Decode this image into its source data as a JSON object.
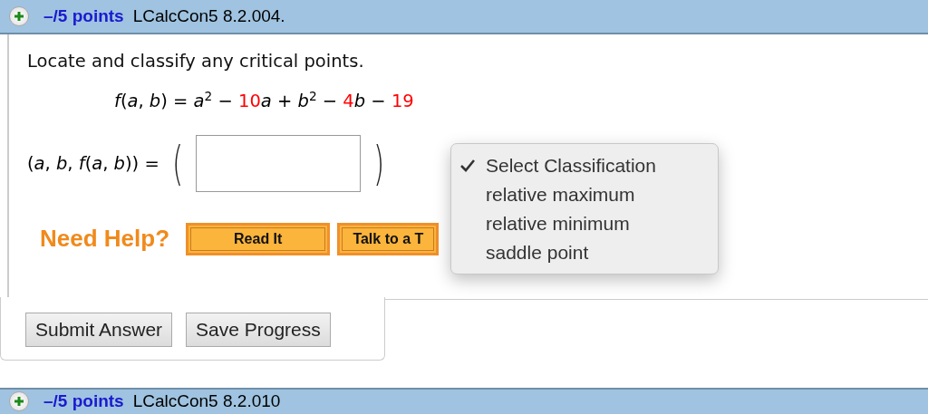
{
  "question_header": {
    "points": "–/5 points",
    "code": "LCalcCon5 8.2.004.",
    "expanded": false
  },
  "prompt": "Locate and classify any critical points.",
  "formula": [
    {
      "text": "*f*(*a*, *b*) = *a*$^{2}$ − ",
      "color": "#000000"
    },
    {
      "text": "10",
      "color": "#ff0000"
    },
    {
      "text": "*a* + *b*$^{2}$ − ",
      "color": "#000000"
    },
    {
      "text": "4",
      "color": "#ff0000"
    },
    {
      "text": "*b* − ",
      "color": "#000000"
    },
    {
      "text": "19",
      "color": "#ff0000"
    }
  ],
  "answer": {
    "label": "(*a*, *b*, *f*(*a*, *b*)) =",
    "open_paren": "(",
    "close_paren": ")"
  },
  "help": {
    "label": "Need Help?",
    "buttons": [
      "Read It",
      "Talk to a T"
    ]
  },
  "classification_menu": {
    "options": [
      {
        "label": "Select Classification",
        "selected": true
      },
      {
        "label": "relative maximum",
        "selected": false
      },
      {
        "label": "relative minimum",
        "selected": false
      },
      {
        "label": "saddle point",
        "selected": false
      }
    ]
  },
  "actions": [
    "Submit Answer",
    "Save Progress"
  ],
  "next_question_header": {
    "points": "–/5 points",
    "code": "LCalcCon5 8.2.010",
    "expanded": false
  }
}
